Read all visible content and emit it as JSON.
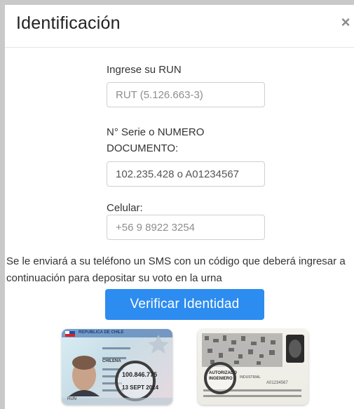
{
  "modal": {
    "title": "Identificación",
    "close_symbol": "×"
  },
  "form": {
    "run_label": "Ingrese su RUN",
    "run_placeholder": "RUT (5.126.663-3)",
    "serie_label": "N° Serie o NUMERO DOCUMENTO:",
    "serie_value": "102.235.428 o A01234567",
    "celular_label": "Celular:",
    "celular_placeholder": "+56 9 8922 3254"
  },
  "info_text": "Se le enviará a su teléfono un SMS con un código que deberá ingresar a continuación para depositar su voto en la urna",
  "verify_button_label": "Verificar Identidad",
  "id_card_front": {
    "header": "REPUBLICA DE CHILE",
    "nationality": "CHILENA",
    "run_number": "100.846.775",
    "expiry": "13 SEPT 2024",
    "run_tag": "RUN"
  },
  "id_card_back": {
    "number": "A01234567",
    "line1": "AUTORIZADO",
    "line2": "INGENIERO",
    "line3": "INDUSTRIAL"
  },
  "colors": {
    "button": "#2d8cf0",
    "frame": "#c9c9c9"
  }
}
